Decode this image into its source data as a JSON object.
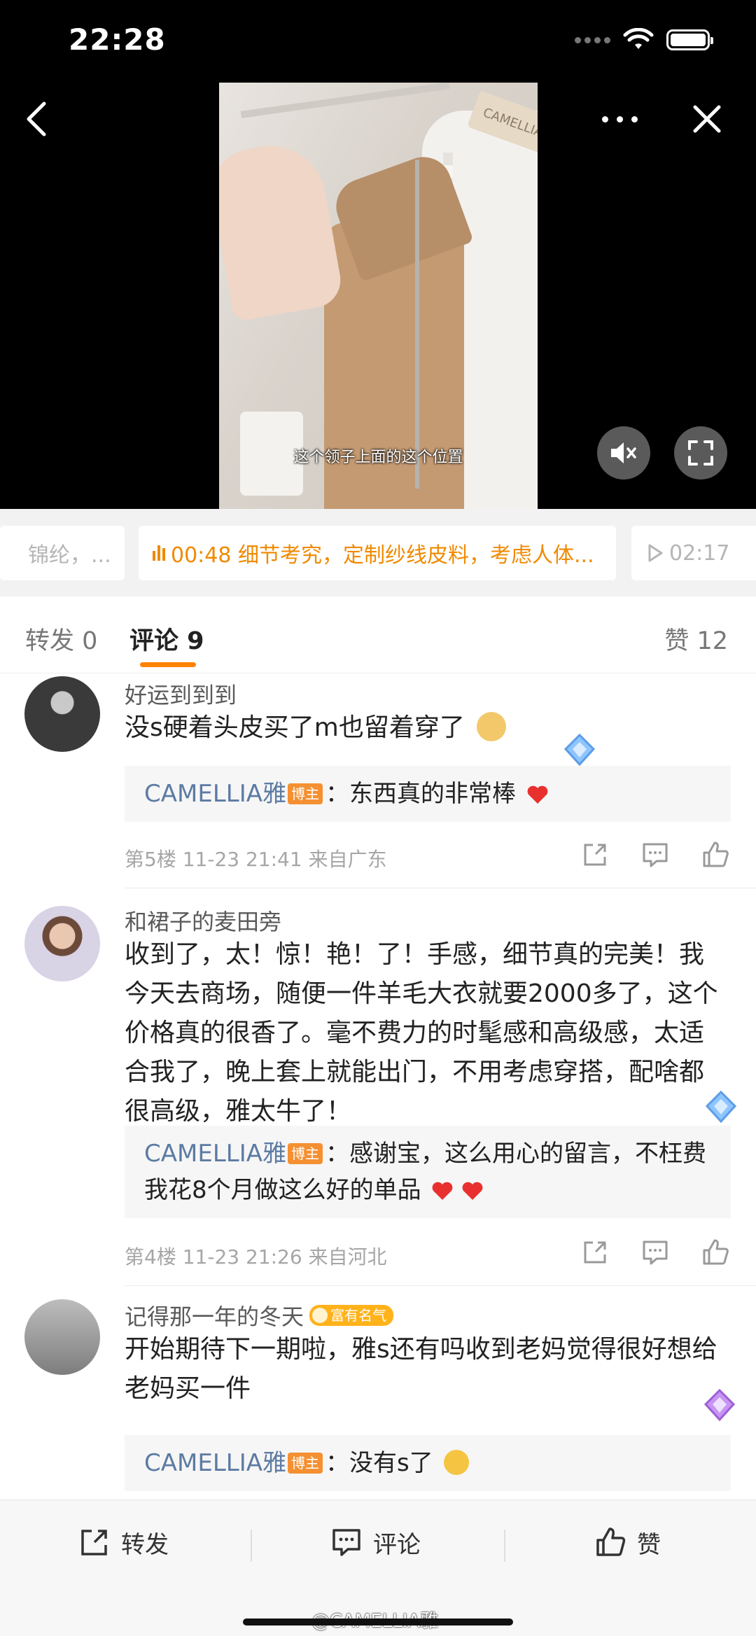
{
  "status_bar": {
    "time": "22:28"
  },
  "video": {
    "subtitle": "这个领子上面的这个位置",
    "tag_text": "CAMELLIA"
  },
  "chapters": {
    "prev": "锦纶，...",
    "active": "00:48 细节考究，定制纱线皮料，考虑人体...",
    "next": "02:17"
  },
  "tabs": {
    "repost": "转发 0",
    "comment": "评论 9",
    "like": "赞 12"
  },
  "comments": [
    {
      "username": "好运到到到",
      "text": "没s硬着头皮买了m也留着穿了",
      "reply_user": "CAMELLIA雅",
      "reply_badge": "博主",
      "reply_text": "：东西真的非常棒",
      "meta": "第5楼 11-23 21:41 来自广东"
    },
    {
      "username": "和裙子的麦田旁",
      "text": "收到了，太！惊！艳！了！手感，细节真的完美！我今天去商场，随便一件羊毛大衣就要2000多了，这个价格真的很香了。毫不费力的时髦感和高级感，太适合我了，晚上套上就能出门，不用考虑穿搭，配啥都很高级，雅太牛了！",
      "reply_user": "CAMELLIA雅",
      "reply_badge": "博主",
      "reply_text": "：感谢宝，这么用心的留言，不枉费我花8个月做这么好的单品",
      "meta": "第4楼 11-23 21:26 来自河北"
    },
    {
      "username": "记得那一年的冬天",
      "fame_badge": "富有名气",
      "text": "开始期待下一期啦，雅s还有吗收到老妈觉得很好想给老妈买一件",
      "reply_user": "CAMELLIA雅",
      "reply_badge": "博主",
      "reply_text": "：没有s了"
    }
  ],
  "bottom_bar": {
    "repost": "转发",
    "comment": "评论",
    "like": "赞"
  },
  "watermark": "@CAMELLIA雅",
  "colors": {
    "accent": "#ff8200",
    "chapter_active": "#f08a00",
    "reply_user": "#5c7ba3",
    "author_badge": "#f59032",
    "heart": "#e8312f"
  },
  "icons": [
    "back-icon",
    "more-icon",
    "close-icon",
    "mute-icon",
    "fullscreen-icon",
    "repost-icon",
    "comment-icon",
    "like-icon",
    "vip-gem-icon",
    "heart-icon",
    "emoji-icon"
  ]
}
